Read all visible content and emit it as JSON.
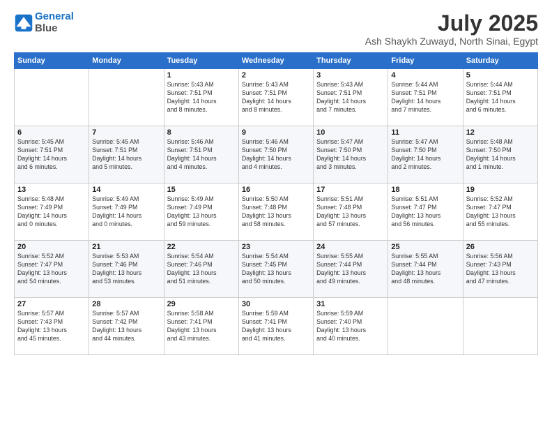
{
  "header": {
    "logo_line1": "General",
    "logo_line2": "Blue",
    "title": "July 2025",
    "subtitle": "Ash Shaykh Zuwayd, North Sinai, Egypt"
  },
  "weekdays": [
    "Sunday",
    "Monday",
    "Tuesday",
    "Wednesday",
    "Thursday",
    "Friday",
    "Saturday"
  ],
  "weeks": [
    [
      {
        "day": "",
        "text": ""
      },
      {
        "day": "",
        "text": ""
      },
      {
        "day": "1",
        "text": "Sunrise: 5:43 AM\nSunset: 7:51 PM\nDaylight: 14 hours\nand 8 minutes."
      },
      {
        "day": "2",
        "text": "Sunrise: 5:43 AM\nSunset: 7:51 PM\nDaylight: 14 hours\nand 8 minutes."
      },
      {
        "day": "3",
        "text": "Sunrise: 5:43 AM\nSunset: 7:51 PM\nDaylight: 14 hours\nand 7 minutes."
      },
      {
        "day": "4",
        "text": "Sunrise: 5:44 AM\nSunset: 7:51 PM\nDaylight: 14 hours\nand 7 minutes."
      },
      {
        "day": "5",
        "text": "Sunrise: 5:44 AM\nSunset: 7:51 PM\nDaylight: 14 hours\nand 6 minutes."
      }
    ],
    [
      {
        "day": "6",
        "text": "Sunrise: 5:45 AM\nSunset: 7:51 PM\nDaylight: 14 hours\nand 6 minutes."
      },
      {
        "day": "7",
        "text": "Sunrise: 5:45 AM\nSunset: 7:51 PM\nDaylight: 14 hours\nand 5 minutes."
      },
      {
        "day": "8",
        "text": "Sunrise: 5:46 AM\nSunset: 7:51 PM\nDaylight: 14 hours\nand 4 minutes."
      },
      {
        "day": "9",
        "text": "Sunrise: 5:46 AM\nSunset: 7:50 PM\nDaylight: 14 hours\nand 4 minutes."
      },
      {
        "day": "10",
        "text": "Sunrise: 5:47 AM\nSunset: 7:50 PM\nDaylight: 14 hours\nand 3 minutes."
      },
      {
        "day": "11",
        "text": "Sunrise: 5:47 AM\nSunset: 7:50 PM\nDaylight: 14 hours\nand 2 minutes."
      },
      {
        "day": "12",
        "text": "Sunrise: 5:48 AM\nSunset: 7:50 PM\nDaylight: 14 hours\nand 1 minute."
      }
    ],
    [
      {
        "day": "13",
        "text": "Sunrise: 5:48 AM\nSunset: 7:49 PM\nDaylight: 14 hours\nand 0 minutes."
      },
      {
        "day": "14",
        "text": "Sunrise: 5:49 AM\nSunset: 7:49 PM\nDaylight: 14 hours\nand 0 minutes."
      },
      {
        "day": "15",
        "text": "Sunrise: 5:49 AM\nSunset: 7:49 PM\nDaylight: 13 hours\nand 59 minutes."
      },
      {
        "day": "16",
        "text": "Sunrise: 5:50 AM\nSunset: 7:48 PM\nDaylight: 13 hours\nand 58 minutes."
      },
      {
        "day": "17",
        "text": "Sunrise: 5:51 AM\nSunset: 7:48 PM\nDaylight: 13 hours\nand 57 minutes."
      },
      {
        "day": "18",
        "text": "Sunrise: 5:51 AM\nSunset: 7:47 PM\nDaylight: 13 hours\nand 56 minutes."
      },
      {
        "day": "19",
        "text": "Sunrise: 5:52 AM\nSunset: 7:47 PM\nDaylight: 13 hours\nand 55 minutes."
      }
    ],
    [
      {
        "day": "20",
        "text": "Sunrise: 5:52 AM\nSunset: 7:47 PM\nDaylight: 13 hours\nand 54 minutes."
      },
      {
        "day": "21",
        "text": "Sunrise: 5:53 AM\nSunset: 7:46 PM\nDaylight: 13 hours\nand 53 minutes."
      },
      {
        "day": "22",
        "text": "Sunrise: 5:54 AM\nSunset: 7:46 PM\nDaylight: 13 hours\nand 51 minutes."
      },
      {
        "day": "23",
        "text": "Sunrise: 5:54 AM\nSunset: 7:45 PM\nDaylight: 13 hours\nand 50 minutes."
      },
      {
        "day": "24",
        "text": "Sunrise: 5:55 AM\nSunset: 7:44 PM\nDaylight: 13 hours\nand 49 minutes."
      },
      {
        "day": "25",
        "text": "Sunrise: 5:55 AM\nSunset: 7:44 PM\nDaylight: 13 hours\nand 48 minutes."
      },
      {
        "day": "26",
        "text": "Sunrise: 5:56 AM\nSunset: 7:43 PM\nDaylight: 13 hours\nand 47 minutes."
      }
    ],
    [
      {
        "day": "27",
        "text": "Sunrise: 5:57 AM\nSunset: 7:43 PM\nDaylight: 13 hours\nand 45 minutes."
      },
      {
        "day": "28",
        "text": "Sunrise: 5:57 AM\nSunset: 7:42 PM\nDaylight: 13 hours\nand 44 minutes."
      },
      {
        "day": "29",
        "text": "Sunrise: 5:58 AM\nSunset: 7:41 PM\nDaylight: 13 hours\nand 43 minutes."
      },
      {
        "day": "30",
        "text": "Sunrise: 5:59 AM\nSunset: 7:41 PM\nDaylight: 13 hours\nand 41 minutes."
      },
      {
        "day": "31",
        "text": "Sunrise: 5:59 AM\nSunset: 7:40 PM\nDaylight: 13 hours\nand 40 minutes."
      },
      {
        "day": "",
        "text": ""
      },
      {
        "day": "",
        "text": ""
      }
    ]
  ]
}
